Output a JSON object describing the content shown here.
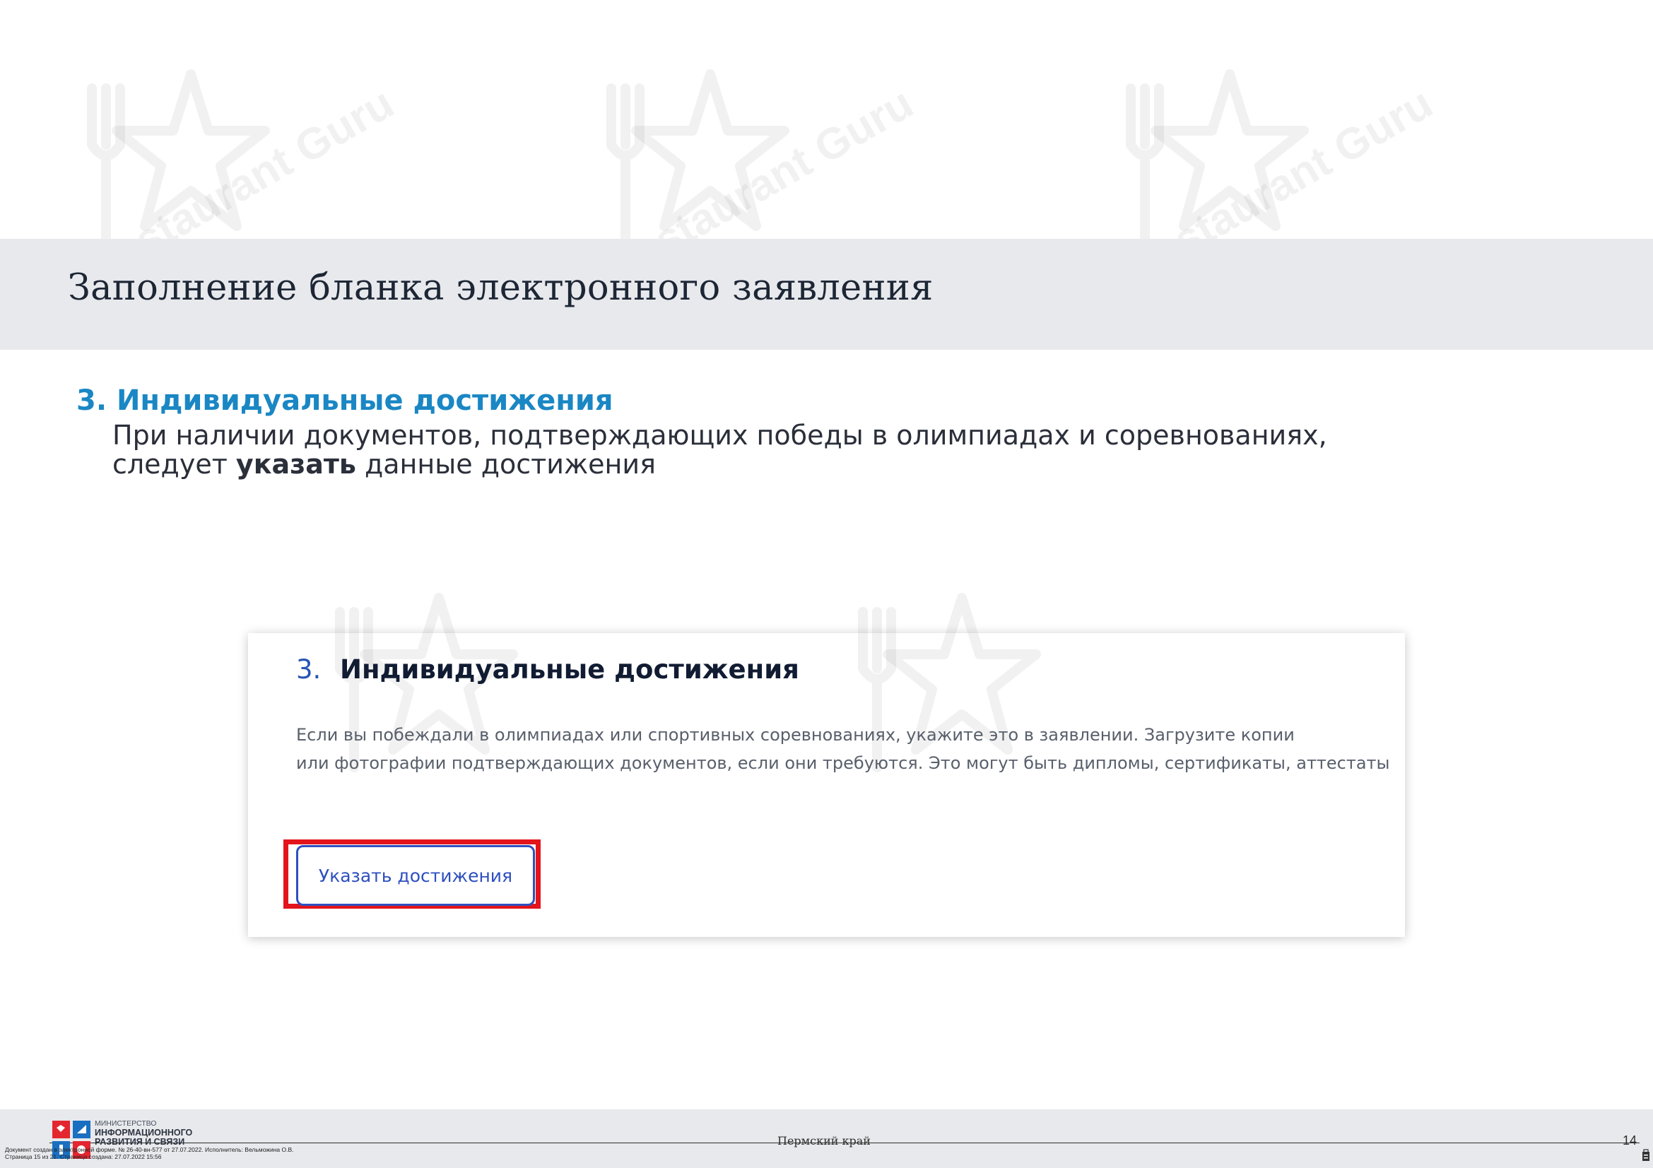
{
  "watermark": {
    "text": "Restaurant Guru"
  },
  "header": {
    "title": "Заполнение бланка электронного заявления"
  },
  "section": {
    "heading": "3. Индивидуальные достижения",
    "body_line1": "При наличии документов, подтверждающих победы в олимпиадах и соревнованиях,",
    "body_line2_start": "следует ",
    "body_line2_bold": "указать",
    "body_line2_end": " данные достижения"
  },
  "card": {
    "number": "3.",
    "title": "Индивидуальные достижения",
    "text_line1": "Если вы побеждали в олимпиадах или спортивных соревнованиях, укажите это в заявлении. Загрузите копии",
    "text_line2": "или фотографии подтверждающих документов, если они требуются. Это могут быть дипломы, сертификаты, аттестаты",
    "button_label": "Указать достижения",
    "highlight_color": "#e3141b",
    "accent_color": "#2e4fbf"
  },
  "footer": {
    "ministry_line1": "МИНИСТЕРСТВО",
    "ministry_line2": "ИНФОРМАЦИОННОГО",
    "ministry_line3": "РАЗВИТИЯ И СВЯЗИ",
    "region": "Пермский край",
    "page_number": "14",
    "stamp_line1": "Документ создан в электронной форме. № 26-40-вн-577 от 27.07.2022. Исполнитель: Вельможина О.В.",
    "stamp_line2": "Страница 15 из 21. Страница создана: 27.07.2022 15:56"
  },
  "colors": {
    "title_band": "#e7e9ec",
    "section_heading": "#1a87c4",
    "page_title": "#1d2635"
  }
}
